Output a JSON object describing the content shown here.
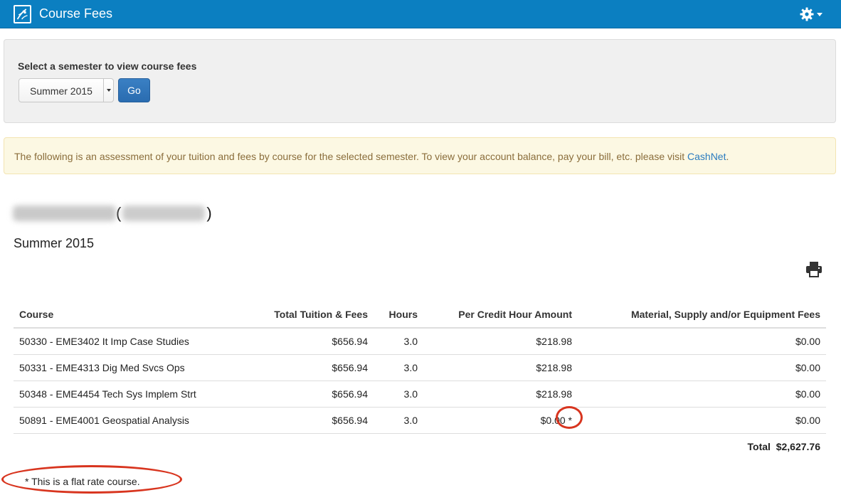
{
  "header": {
    "app_title": "Course Fees",
    "logo_icon": "university-logo-icon",
    "settings_icon": "gear-icon",
    "background_color": "#0b7fc1"
  },
  "semester_select": {
    "label": "Select a semester to view course fees",
    "selected": "Summer 2015",
    "go_label": "Go"
  },
  "notice": {
    "text": "The following is an assessment of your tuition and fees by course for the selected semester. To view your account balance, pay your bill, etc. please visit ",
    "link_text": "CashNet",
    "suffix": "."
  },
  "student": {
    "open_paren": "(",
    "close_paren": ")"
  },
  "semester_title": "Summer 2015",
  "fee_table": {
    "headers": {
      "course": "Course",
      "total": "Total Tuition & Fees",
      "hours": "Hours",
      "per_credit": "Per Credit Hour Amount",
      "materials": "Material, Supply and/or Equipment Fees"
    },
    "rows": [
      {
        "course": "50330 - EME3402 It Imp Case Studies",
        "total": "$656.94",
        "hours": "3.0",
        "per_credit": "$218.98",
        "materials": "$0.00"
      },
      {
        "course": "50331 - EME4313 Dig Med Svcs Ops",
        "total": "$656.94",
        "hours": "3.0",
        "per_credit": "$218.98",
        "materials": "$0.00"
      },
      {
        "course": "50348 - EME4454 Tech Sys Implem Strt",
        "total": "$656.94",
        "hours": "3.0",
        "per_credit": "$218.98",
        "materials": "$0.00"
      },
      {
        "course": "50891 - EME4001 Geospatial Analysis",
        "total": "$656.94",
        "hours": "3.0",
        "per_credit": "$0.00 *",
        "materials": "$0.00"
      }
    ],
    "total_label": "Total",
    "total_value": "$2,627.76"
  },
  "footnote": "* This is a flat rate course.",
  "annotation_color": "#d8351f"
}
